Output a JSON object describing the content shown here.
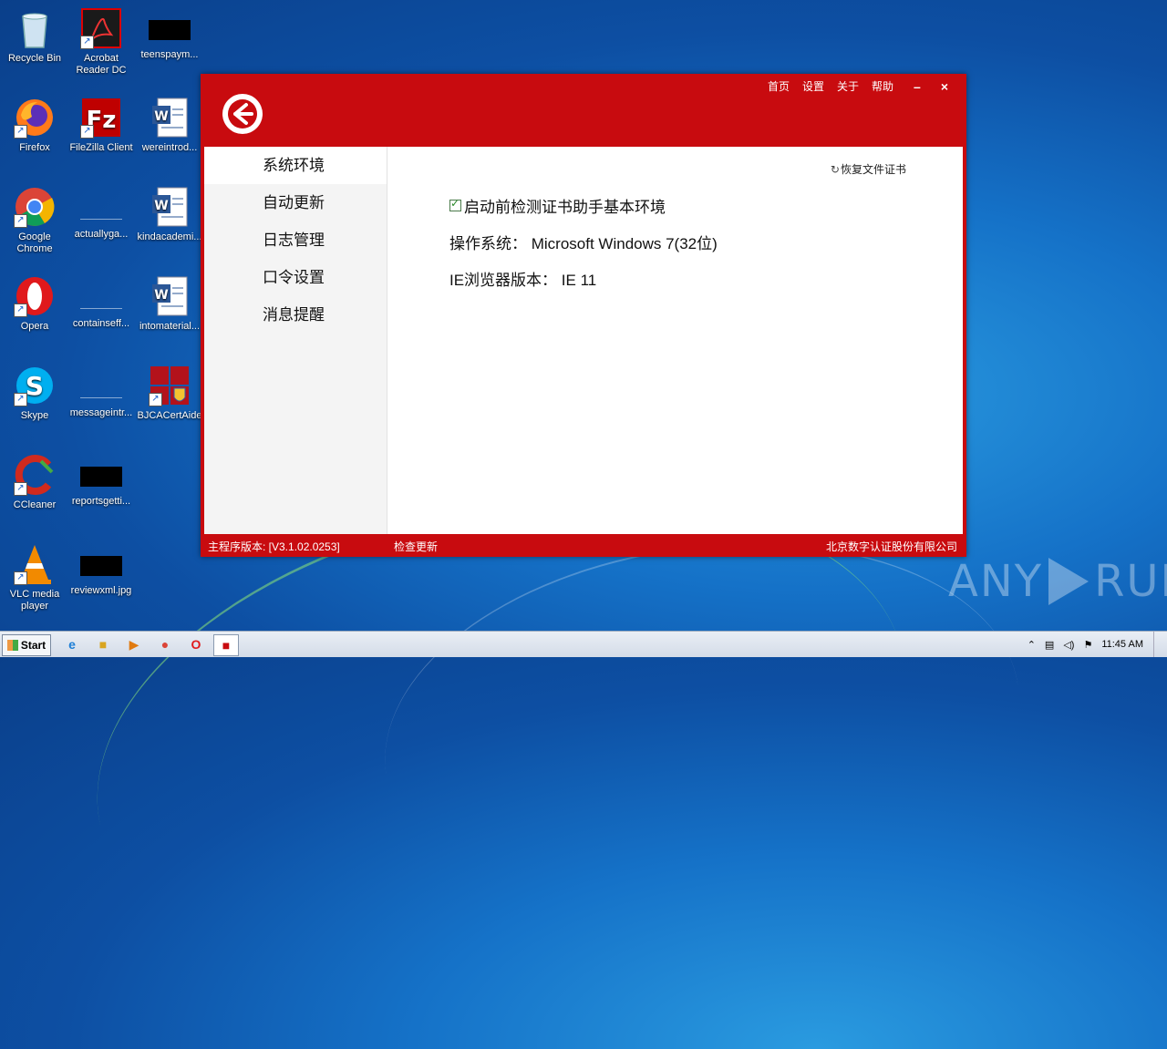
{
  "desktop": {
    "icons": [
      {
        "label": "Recycle Bin"
      },
      {
        "label": "Acrobat Reader DC"
      },
      {
        "label": "teenspaym..."
      },
      {
        "label": "Firefox"
      },
      {
        "label": "FileZilla Client"
      },
      {
        "label": "wereintrod..."
      },
      {
        "label": "Google Chrome"
      },
      {
        "label": "actuallyga..."
      },
      {
        "label": "kindacademi..."
      },
      {
        "label": "Opera"
      },
      {
        "label": "containseff..."
      },
      {
        "label": "intomaterial..."
      },
      {
        "label": "Skype"
      },
      {
        "label": "messageintr..."
      },
      {
        "label": "BJCACertAide"
      },
      {
        "label": "CCleaner"
      },
      {
        "label": "reportsgetti..."
      },
      {
        "label": "VLC media player"
      },
      {
        "label": "reviewxml.jpg"
      }
    ]
  },
  "app": {
    "topnav": {
      "home": "首页",
      "settings": "设置",
      "about": "关于",
      "help": "帮助",
      "minimize": "–",
      "close": "×"
    },
    "sidebar": [
      {
        "label": "系统环境"
      },
      {
        "label": "自动更新"
      },
      {
        "label": "日志管理"
      },
      {
        "label": "口令设置"
      },
      {
        "label": "消息提醒"
      }
    ],
    "content": {
      "restore_label": "恢复文件证书",
      "check_label": "启动前检测证书助手基本环境",
      "os_label": "操作系统：",
      "os_value": "Microsoft Windows 7(32位)",
      "ie_label": "IE浏览器版本：",
      "ie_value": "IE 11"
    },
    "footer": {
      "version": "主程序版本: [V3.1.02.0253]",
      "check_update": "检查更新",
      "company": "北京数字认证股份有限公司"
    }
  },
  "watermark": {
    "left": "ANY",
    "right": "RUN"
  },
  "taskbar": {
    "start_label": "Start",
    "clock": "11:45 AM"
  },
  "colors": {
    "accent": "#c80b0f"
  }
}
